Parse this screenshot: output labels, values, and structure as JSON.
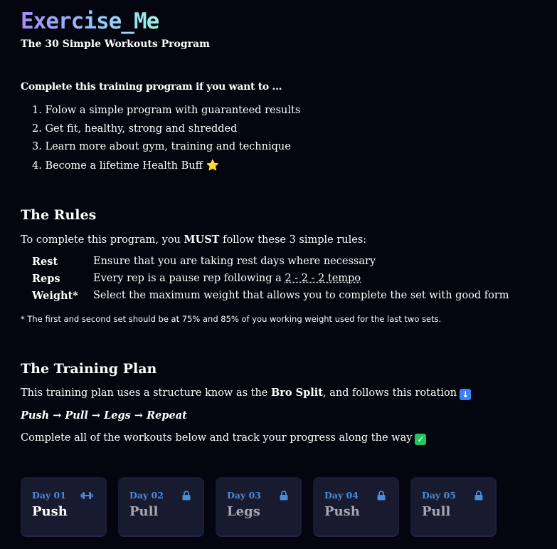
{
  "header": {
    "title": "Exercise_Me",
    "subtitle": "The 30 Simple Workouts Program"
  },
  "intro": {
    "heading": "Complete this training program if you want to ...",
    "goals": [
      "1. Folow a simple program with guaranteed results",
      "2. Get fit, healthy, strong and shredded",
      "3. Learn more about gym, training and technique",
      "4. Become a lifetime Health Buff"
    ],
    "goal_emoji": "⭐"
  },
  "rules": {
    "title": "The Rules",
    "intro_before": "To complete this program, you ",
    "intro_emphasis": "MUST",
    "intro_after": " follow these 3 simple rules:",
    "items": [
      {
        "name": "Rest",
        "desc": "Ensure that you are taking rest days where necessary"
      },
      {
        "name": "Reps",
        "desc_before": "Every rep is a pause rep following a ",
        "desc_link": "2 - 2 - 2 tempo"
      },
      {
        "name": "Weight*",
        "desc": "Select the maximum weight that allows you to complete the set with good form"
      }
    ],
    "note": "* The first and second set should be at 75% and 85% of you working weight used for the last two sets."
  },
  "plan": {
    "title": "The Training Plan",
    "intro_before": "This training plan uses a structure know as the ",
    "intro_emphasis": "Bro Split",
    "intro_after": ", and follows this rotation",
    "rotation": "Push → Pull → Legs → Repeat",
    "track": "Complete all of the workouts below and track your progress along the way"
  },
  "days": [
    {
      "label": "Day 01",
      "name": "Push",
      "icon": "dumbbell-icon",
      "locked": false
    },
    {
      "label": "Day 02",
      "name": "Pull",
      "icon": "lock-icon",
      "locked": true
    },
    {
      "label": "Day 03",
      "name": "Legs",
      "icon": "lock-icon",
      "locked": true
    },
    {
      "label": "Day 04",
      "name": "Push",
      "icon": "lock-icon",
      "locked": true
    },
    {
      "label": "Day 05",
      "name": "Pull",
      "icon": "lock-icon",
      "locked": true
    }
  ],
  "colors": {
    "background": "#04050e",
    "card": "#181a2f",
    "day_label": "#4c8bd6",
    "title_gradient_start": "#a78bfa",
    "title_gradient_end": "#99f6e4"
  }
}
